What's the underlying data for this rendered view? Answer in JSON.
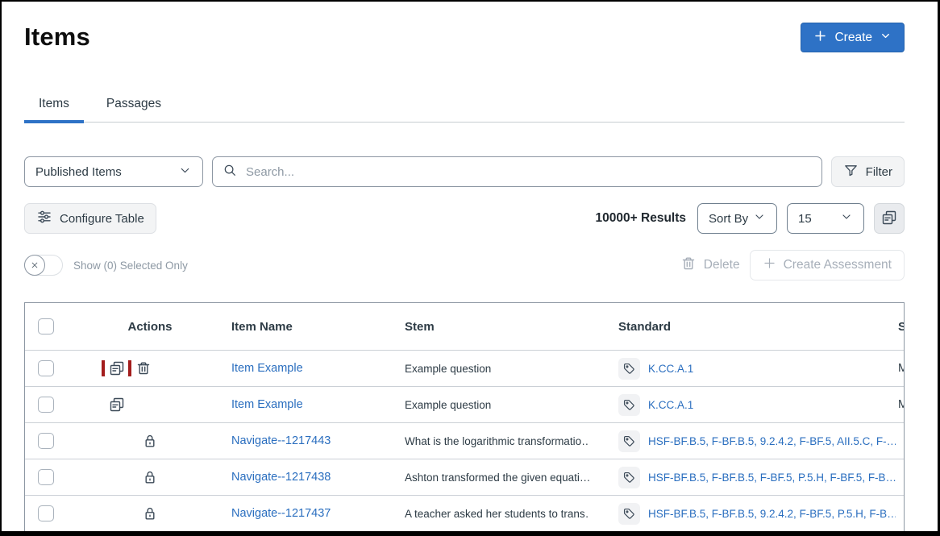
{
  "page": {
    "title": "Items"
  },
  "create_button": {
    "label": "Create"
  },
  "tabs": {
    "items": "Items",
    "passages": "Passages"
  },
  "filters": {
    "published_select": {
      "value": "Published Items"
    },
    "search": {
      "placeholder": "Search..."
    },
    "filter_button": {
      "label": "Filter"
    },
    "configure_button": {
      "label": "Configure Table"
    },
    "results_text": "10000+ Results",
    "sort_select": {
      "value": "Sort By"
    },
    "page_size_select": {
      "value": "15"
    },
    "selection_bar": {
      "toggle_label": "Show (0) Selected Only",
      "delete_label": "Delete",
      "create_assessment_label": "Create Assessment"
    }
  },
  "table": {
    "columns": {
      "actions": "Actions",
      "item_name": "Item Name",
      "stem": "Stem",
      "standard": "Standard",
      "subject": "Subject"
    },
    "rows": [
      {
        "actions": [
          "copy",
          "trash"
        ],
        "highlighted_action": "copy",
        "item_name": "Item Example",
        "stem": "Example question",
        "standard": "K.CC.A.1",
        "subject": "Math"
      },
      {
        "actions": [
          "copy"
        ],
        "highlighted_action": "",
        "item_name": "Item Example",
        "stem": "Example question",
        "standard": "K.CC.A.1",
        "subject": "Math"
      },
      {
        "actions": [
          "lock"
        ],
        "highlighted_action": "",
        "item_name": "Navigate--1217443",
        "stem": "What is the logarithmic transformatio…",
        "standard": "HSF-BF.B.5, F-BF.B.5, 9.2.4.2, F-BF.5, AII.5.C, F-…",
        "subject": ""
      },
      {
        "actions": [
          "lock"
        ],
        "highlighted_action": "",
        "item_name": "Navigate--1217438",
        "stem": "Ashton transformed the given equati…",
        "standard": "HSF-BF.B.5, F-BF.B.5, F-BF.5, P.5.H, F-BF.5, F-B…",
        "subject": ""
      },
      {
        "actions": [
          "lock"
        ],
        "highlighted_action": "",
        "item_name": "Navigate--1217437",
        "stem": "A teacher asked her students to trans…",
        "standard": "HSF-BF.B.5, F-BF.B.5, 9.2.4.2, F-BF.5, P.5.H, F-B…",
        "subject": ""
      }
    ]
  },
  "colors": {
    "primary_blue": "#2E72C6",
    "link_blue": "#2A6EBF",
    "annotation_red": "#A31D1D",
    "text_dark": "#2D3B45",
    "muted_gray": "#A7AFB9"
  }
}
